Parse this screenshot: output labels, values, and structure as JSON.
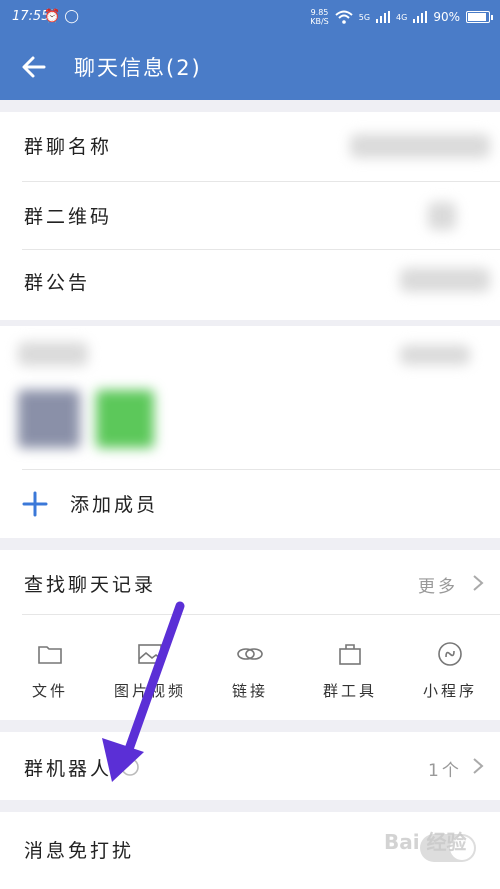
{
  "status_bar": {
    "time": "17:55",
    "left_icons": "⏰ ◯",
    "net_speed_value": "9.85",
    "net_speed_unit": "KB/S",
    "signal1": "5G",
    "signal2": "4G",
    "battery_text": "90%",
    "battery_level": 0.9
  },
  "header": {
    "title": "聊天信息(2)",
    "back_icon": "arrow-left-icon",
    "color": "#4a7cc8"
  },
  "group_info": {
    "name_label": "群聊名称",
    "qr_label": "群二维码",
    "notice_label": "群公告"
  },
  "members": {
    "add_label": "添加成员"
  },
  "history": {
    "search_label": "查找聊天记录",
    "more_label": "更多",
    "tools": [
      {
        "label": "文件",
        "icon": "folder-icon"
      },
      {
        "label": "图片视频",
        "icon": "image-icon"
      },
      {
        "label": "链接",
        "icon": "link-icon"
      },
      {
        "label": "群工具",
        "icon": "toolbox-icon"
      },
      {
        "label": "小程序",
        "icon": "mini-program-icon"
      }
    ]
  },
  "robot": {
    "label": "群机器人",
    "count": "1个"
  },
  "mute": {
    "label": "消息免打扰"
  },
  "annotation": {
    "arrow_color": "#5b2fd6"
  },
  "watermark": {
    "text": "Bai 经验"
  }
}
